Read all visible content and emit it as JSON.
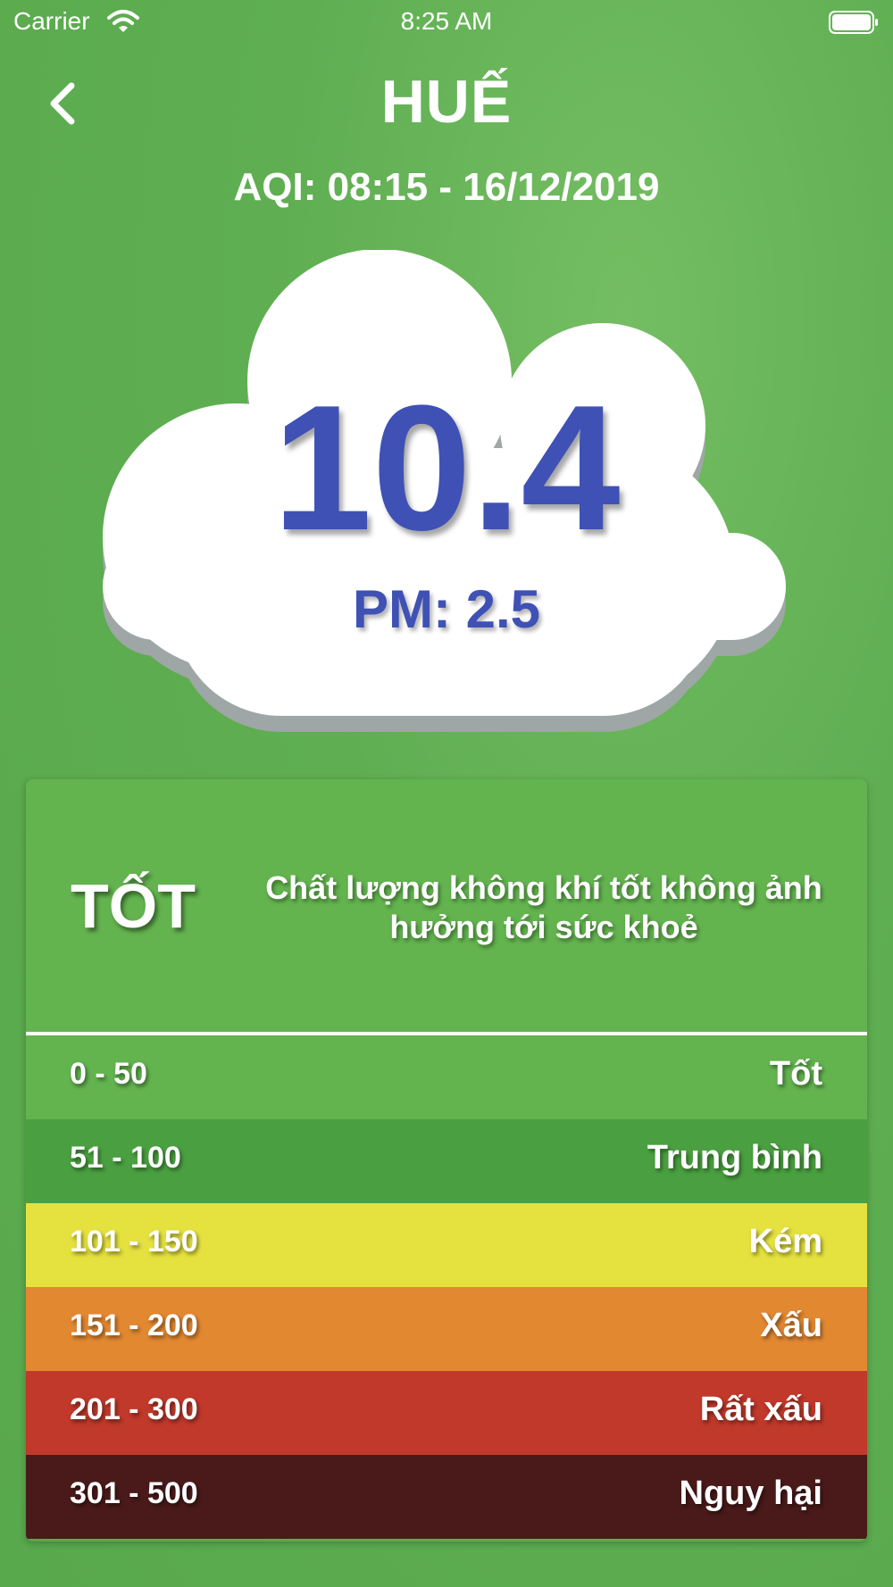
{
  "status_bar": {
    "carrier": "Carrier",
    "time": "8:25 AM"
  },
  "header": {
    "city": "HUẾ",
    "aqi_time": "AQI: 08:15 - 16/12/2019"
  },
  "reading": {
    "value": "10.4",
    "pollutant": "PM: 2.5"
  },
  "current_level": {
    "label": "TỐT",
    "description": "Chất lượng không khí tốt không ảnh hưởng tới sức khoẻ",
    "color": "#63b34f"
  },
  "scale": [
    {
      "range": "0 - 50",
      "label": "Tốt",
      "color": "#63b34f"
    },
    {
      "range": "51 - 100",
      "label": "Trung bình",
      "color": "#4aa040"
    },
    {
      "range": "101 - 150",
      "label": "Kém",
      "color": "#e5e13e"
    },
    {
      "range": "151 - 200",
      "label": "Xấu",
      "color": "#e28831"
    },
    {
      "range": "201 - 300",
      "label": "Rất xấu",
      "color": "#c0392b"
    },
    {
      "range": "301 - 500",
      "label": "Nguy hại",
      "color": "#4a1a1a"
    }
  ],
  "icons": {
    "back": "chevron-left-icon",
    "wifi": "wifi-icon",
    "battery": "battery-icon",
    "cloud": "cloud-shape"
  }
}
